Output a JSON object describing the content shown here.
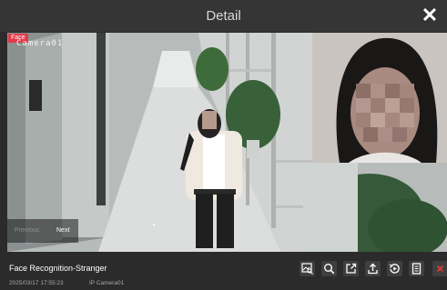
{
  "window": {
    "title": "Detail"
  },
  "viewer": {
    "face_tag": "Face",
    "camera_overlay": "Camera01",
    "nav": {
      "previous": "Previous",
      "next": "Next"
    }
  },
  "event": {
    "title": "Face Recognition-Stranger",
    "timestamp": "2025/03/17 17:55:23",
    "camera": "IP Camera01"
  },
  "toolbar": {
    "buttons": [
      {
        "icon": "image-search-icon"
      },
      {
        "icon": "search-icon"
      },
      {
        "icon": "export-icon"
      },
      {
        "icon": "upload-icon"
      },
      {
        "icon": "playback-icon"
      },
      {
        "icon": "document-icon"
      },
      {
        "icon": "close-icon",
        "color": "#e53935"
      }
    ]
  },
  "colors": {
    "accent_red": "#e23a4a",
    "bar_background": "#2b2b2b"
  }
}
